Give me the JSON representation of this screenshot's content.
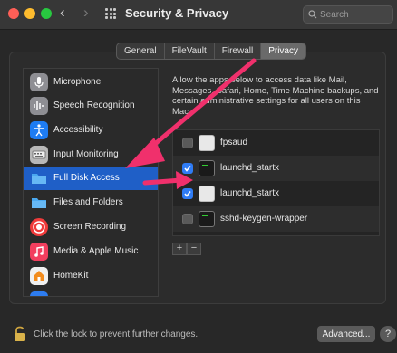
{
  "window": {
    "title": "Security & Privacy",
    "back_glyph": "‹",
    "forward_glyph": "›"
  },
  "search": {
    "placeholder": "Search"
  },
  "tabs": [
    {
      "label": "General",
      "active": false
    },
    {
      "label": "FileVault",
      "active": false
    },
    {
      "label": "Firewall",
      "active": false
    },
    {
      "label": "Privacy",
      "active": true
    }
  ],
  "sidebar": {
    "items": [
      {
        "label": "Microphone",
        "icon": "microphone-icon"
      },
      {
        "label": "Speech Recognition",
        "icon": "waveform-icon"
      },
      {
        "label": "Accessibility",
        "icon": "accessibility-icon"
      },
      {
        "label": "Input Monitoring",
        "icon": "keyboard-icon"
      },
      {
        "label": "Full Disk Access",
        "icon": "folder-icon",
        "selected": true
      },
      {
        "label": "Files and Folders",
        "icon": "folder-icon"
      },
      {
        "label": "Screen Recording",
        "icon": "screen-recording-icon"
      },
      {
        "label": "Media & Apple Music",
        "icon": "music-icon"
      },
      {
        "label": "HomeKit",
        "icon": "home-icon"
      }
    ]
  },
  "description": "Allow the apps below to access data like Mail, Messages, Safari, Home, Time Machine backups, and certain administrative settings for all users on this Mac.",
  "apps": [
    {
      "name": "fpsaud",
      "checked": false,
      "icon": "executable-icon"
    },
    {
      "name": "launchd_startx",
      "checked": true,
      "icon": "terminal-icon"
    },
    {
      "name": "launchd_startx",
      "checked": true,
      "icon": "executable-icon"
    },
    {
      "name": "sshd-keygen-wrapper",
      "checked": false,
      "icon": "terminal-icon"
    }
  ],
  "list_controls": {
    "add": "+",
    "remove": "−"
  },
  "footer": {
    "lock_text": "Click the lock to prevent further changes.",
    "advanced_label": "Advanced...",
    "help_label": "?"
  },
  "colors": {
    "selection": "#1f5fc7",
    "checkbox_on": "#2f7cf6",
    "annotation_arrow": "#f0306c"
  }
}
